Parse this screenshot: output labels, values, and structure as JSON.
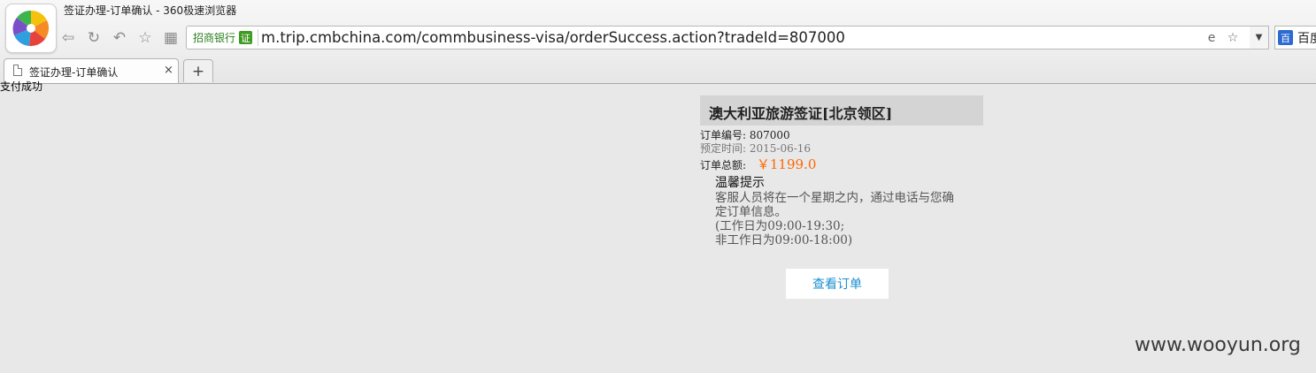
{
  "window": {
    "title": "签证办理-订单确认 - 360极速浏览器"
  },
  "toolbar": {
    "back_icon": "back-arrow-icon",
    "refresh_icon": "refresh-icon",
    "undo_icon": "undo-icon",
    "favorite_icon": "star-icon",
    "apps_icon": "grid-icon"
  },
  "address_bar": {
    "site_badge": "招商银行",
    "cert_label": "证",
    "url": "m.trip.cmbchina.com/commbusiness-visa/orderSuccess.action?tradeId=807000",
    "ie_mode_icon": "e",
    "favorite_icon": "☆"
  },
  "search": {
    "engine_icon": "百",
    "engine_label": "百度"
  },
  "tabs": [
    {
      "title": "签证办理-订单确认",
      "close": "×"
    }
  ],
  "new_tab_label": "+",
  "page": {
    "status_text": "支付成功",
    "product_title": "澳大利亚旅游签证[北京领区]",
    "order_no_label": "订单编号:",
    "order_no": "807000",
    "booking_time_label": "预定时间:",
    "booking_time": "2015-06-16",
    "total_label": "订单总额:",
    "total_amount": "￥1199.0",
    "tips": {
      "title": "温馨提示",
      "lines": [
        "客服人员将在一个星期之内，通过电话与您确",
        "定订单信息。",
        "(工作日为09:00-19:30;",
        "非工作日为09:00-18:00)"
      ]
    },
    "view_order_button": "查看订单"
  },
  "watermark": "www.wooyun.org",
  "colors": {
    "accent_amount": "#ff6600",
    "link_button": "#1a8fd0",
    "cert_green": "#3d9b22"
  }
}
